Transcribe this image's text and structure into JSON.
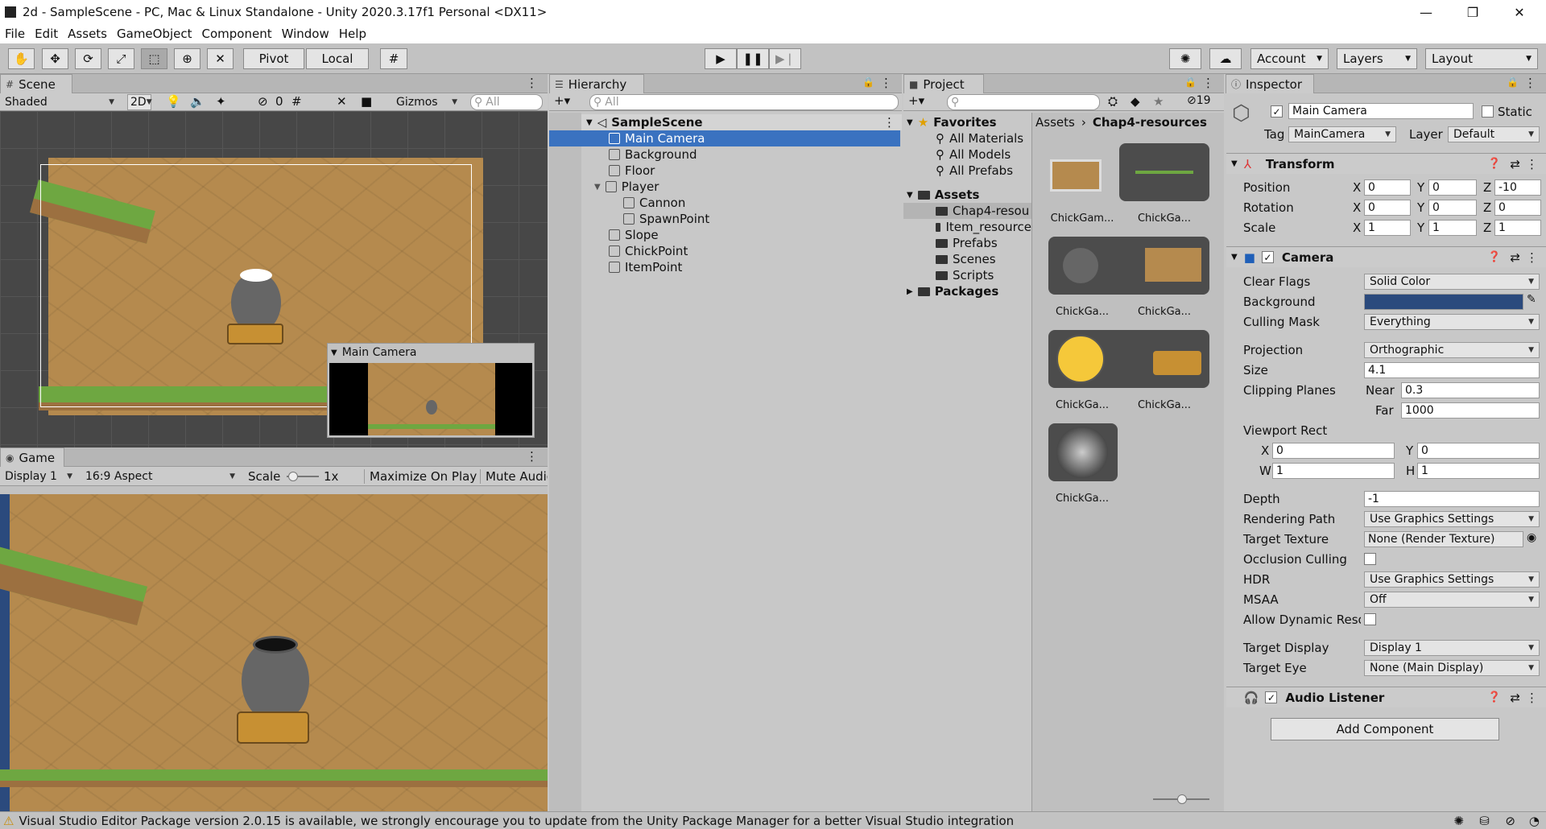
{
  "window": {
    "title": "2d - SampleScene - PC, Mac & Linux Standalone - Unity 2020.3.17f1 Personal <DX11>",
    "minimize": "—",
    "maximize": "❐",
    "close": "✕"
  },
  "menu": [
    "File",
    "Edit",
    "Assets",
    "GameObject",
    "Component",
    "Window",
    "Help"
  ],
  "toolbar": {
    "pivot": "Pivot",
    "local": "Local",
    "account": "Account",
    "layers": "Layers",
    "layout": "Layout"
  },
  "scene": {
    "tab": "Scene",
    "shading": "Shaded",
    "mode2d": "2D",
    "hidden_count": "0",
    "gizmos": "Gizmos",
    "search_placeholder": "All",
    "camera_preview_title": "Main Camera"
  },
  "game": {
    "tab": "Game",
    "display": "Display 1",
    "aspect": "16:9 Aspect",
    "scale_label": "Scale",
    "scale_value": "1x",
    "maximize": "Maximize On Play",
    "mute": "Mute Audio"
  },
  "hierarchy": {
    "tab": "Hierarchy",
    "search_placeholder": "All",
    "scene_name": "SampleScene",
    "items": [
      {
        "label": "Main Camera",
        "depth": 1,
        "selected": true
      },
      {
        "label": "Background",
        "depth": 1
      },
      {
        "label": "Floor",
        "depth": 1
      },
      {
        "label": "Player",
        "depth": 1,
        "expanded": true
      },
      {
        "label": "Cannon",
        "depth": 2
      },
      {
        "label": "SpawnPoint",
        "depth": 2
      },
      {
        "label": "Slope",
        "depth": 1
      },
      {
        "label": "ChickPoint",
        "depth": 1
      },
      {
        "label": "ItemPoint",
        "depth": 1
      }
    ]
  },
  "project": {
    "tab": "Project",
    "hidden_count": "19",
    "favorites_label": "Favorites",
    "favorites": [
      "All Materials",
      "All Models",
      "All Prefabs"
    ],
    "assets_label": "Assets",
    "asset_folders": [
      "Chap4-resou",
      "Item_resource",
      "Prefabs",
      "Scenes",
      "Scripts"
    ],
    "packages_label": "Packages",
    "breadcrumb": [
      "Assets",
      "Chap4-resources"
    ],
    "thumbnails": [
      "ChickGam...",
      "ChickGa...",
      "ChickGa...",
      "ChickGa...",
      "ChickGa...",
      "ChickGa...",
      "ChickGa..."
    ]
  },
  "inspector": {
    "tab": "Inspector",
    "object_name": "Main Camera",
    "static_label": "Static",
    "tag_label": "Tag",
    "tag": "MainCamera",
    "layer_label": "Layer",
    "layer": "Default",
    "transform": {
      "title": "Transform",
      "rows": [
        {
          "label": "Position",
          "x": "0",
          "y": "0",
          "z": "-10"
        },
        {
          "label": "Rotation",
          "x": "0",
          "y": "0",
          "z": "0"
        },
        {
          "label": "Scale",
          "x": "1",
          "y": "1",
          "z": "1"
        }
      ]
    },
    "camera": {
      "title": "Camera",
      "clear_flags_label": "Clear Flags",
      "clear_flags": "Solid Color",
      "background_label": "Background",
      "background_color": "#2b4a7d",
      "culling_mask_label": "Culling Mask",
      "culling_mask": "Everything",
      "projection_label": "Projection",
      "projection": "Orthographic",
      "size_label": "Size",
      "size": "4.1",
      "clipping_label": "Clipping Planes",
      "near_label": "Near",
      "near": "0.3",
      "far_label": "Far",
      "far": "1000",
      "viewport_label": "Viewport Rect",
      "vx": "0",
      "vy": "0",
      "vw": "1",
      "vh": "1",
      "depth_label": "Depth",
      "depth": "-1",
      "rendering_path_label": "Rendering Path",
      "rendering_path": "Use Graphics Settings",
      "target_texture_label": "Target Texture",
      "target_texture": "None (Render Texture)",
      "occlusion_label": "Occlusion Culling",
      "hdr_label": "HDR",
      "hdr": "Use Graphics Settings",
      "msaa_label": "MSAA",
      "msaa": "Off",
      "dynamic_res_label": "Allow Dynamic Reso",
      "target_display_label": "Target Display",
      "target_display": "Display 1",
      "target_eye_label": "Target Eye",
      "target_eye": "None (Main Display)"
    },
    "audio_listener": "Audio Listener",
    "add_component": "Add Component"
  },
  "status": {
    "message": "Visual Studio Editor Package version 2.0.15 is available, we strongly encourage you to update from the Unity Package Manager for a better Visual Studio integration"
  },
  "colors": {
    "selection": "#3a72c0",
    "grass": "#6ea741",
    "dirt": "#b58a4e",
    "background_swatch": "#2b4a7d"
  }
}
